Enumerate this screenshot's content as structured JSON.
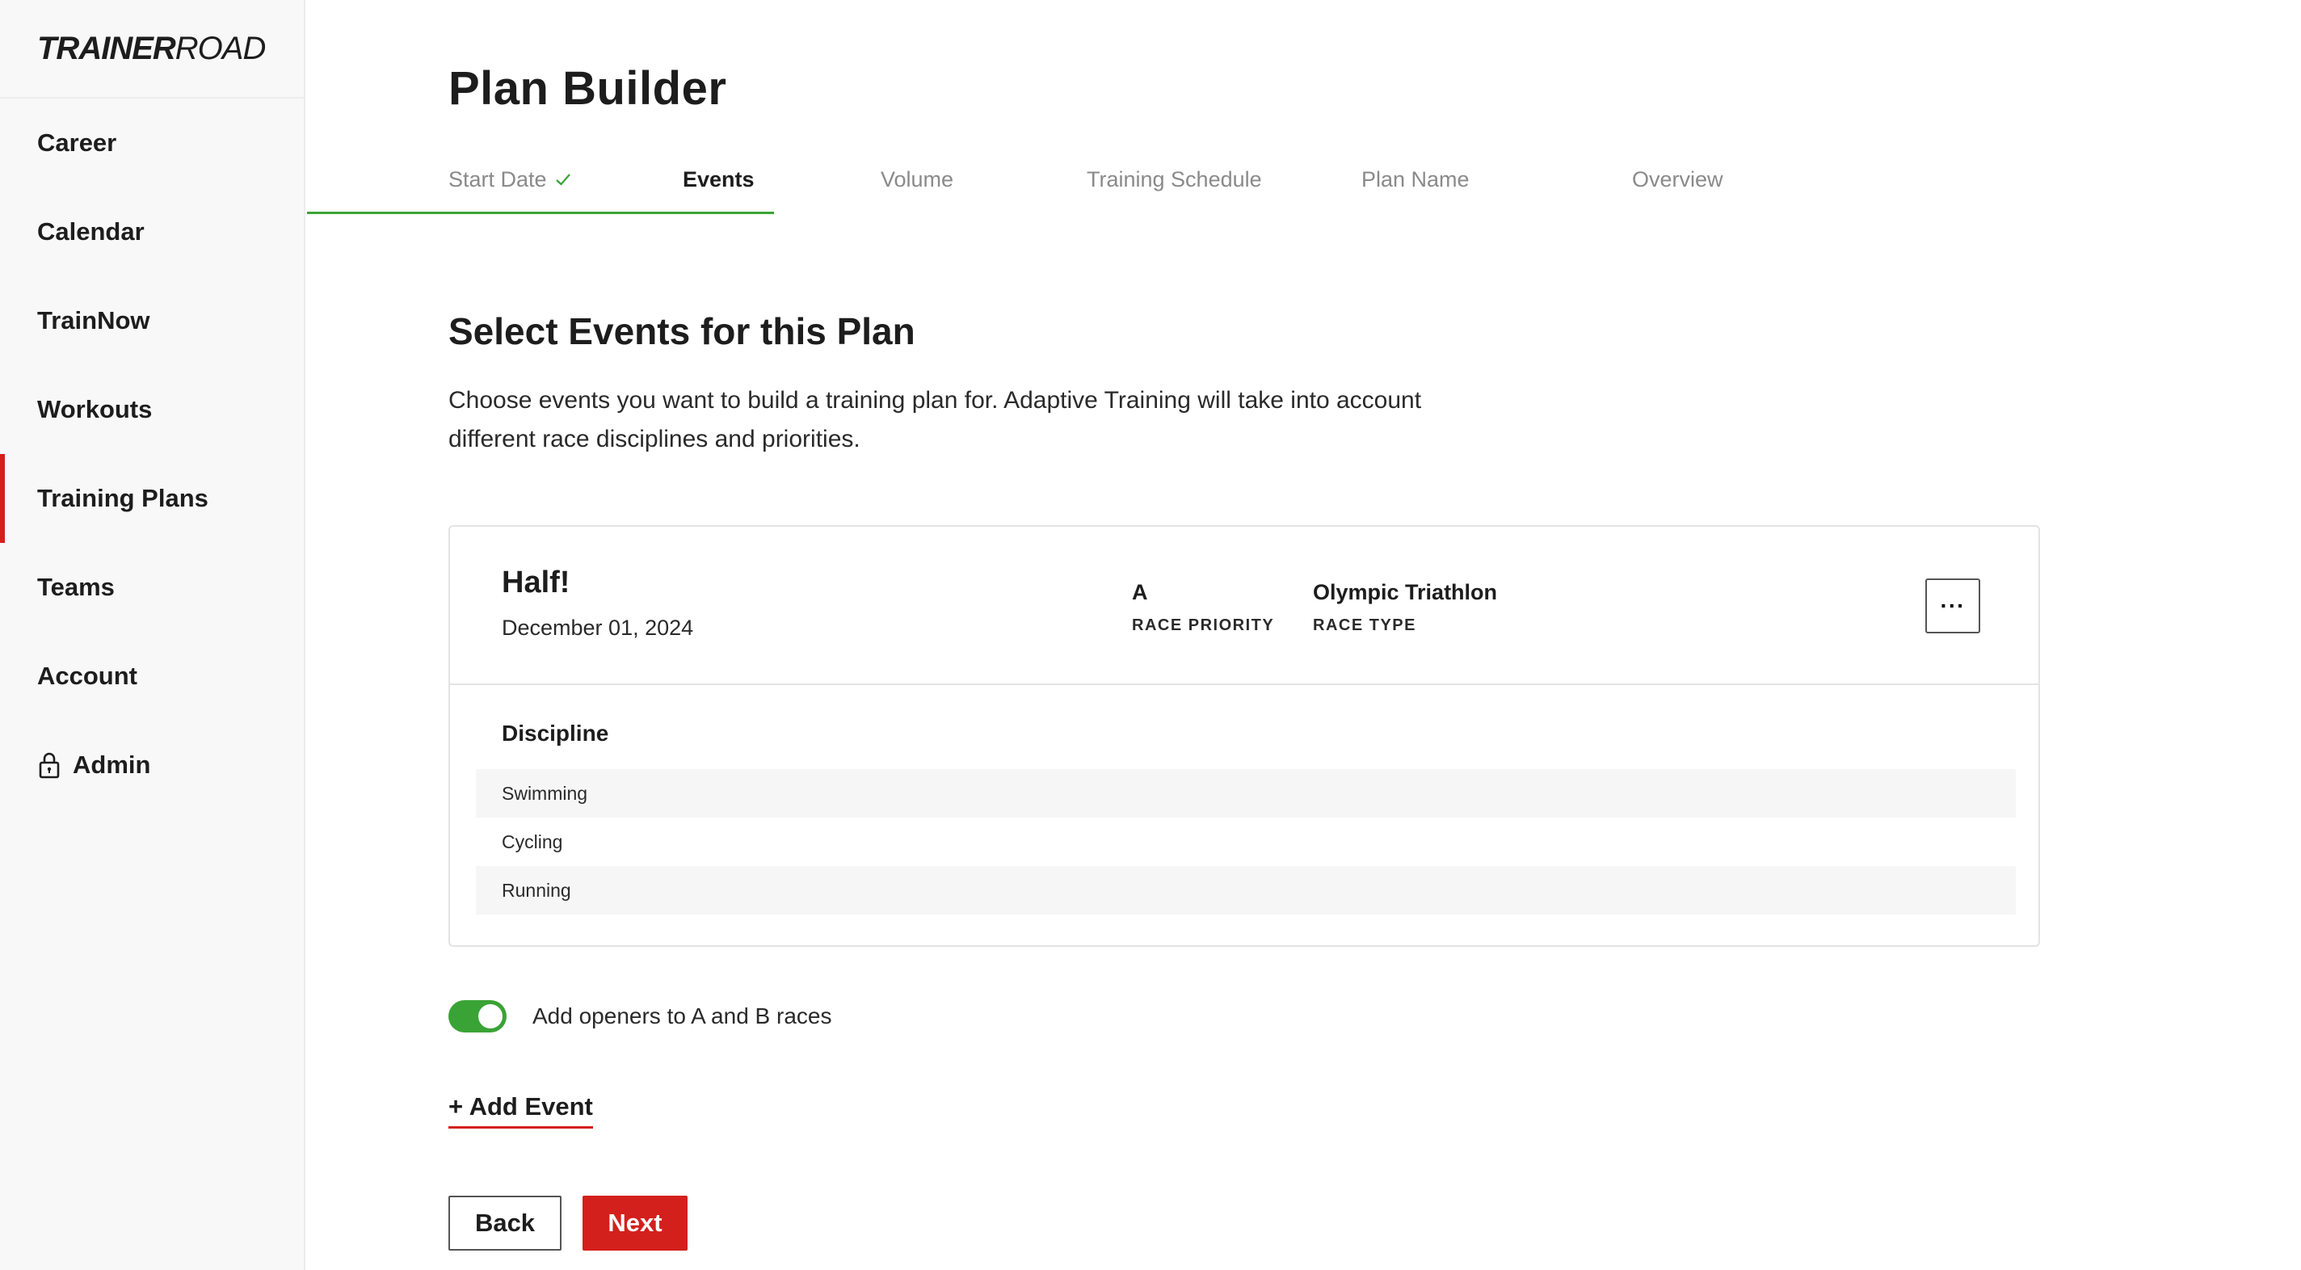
{
  "brand": {
    "logo_bold": "TRAINER",
    "logo_light": "ROAD"
  },
  "sidebar": {
    "items": [
      {
        "label": "Career"
      },
      {
        "label": "Calendar"
      },
      {
        "label": "TrainNow"
      },
      {
        "label": "Workouts"
      },
      {
        "label": "Training Plans",
        "active": true
      },
      {
        "label": "Teams"
      },
      {
        "label": "Account"
      },
      {
        "label": "Admin",
        "icon": "lock-icon"
      }
    ]
  },
  "page": {
    "title": "Plan Builder"
  },
  "steps": [
    {
      "label": "Start Date",
      "state": "completed",
      "icon": "check-icon"
    },
    {
      "label": "Events",
      "state": "current"
    },
    {
      "label": "Volume",
      "state": "upcoming"
    },
    {
      "label": "Training Schedule",
      "state": "upcoming"
    },
    {
      "label": "Plan Name",
      "state": "upcoming"
    },
    {
      "label": "Overview",
      "state": "upcoming"
    }
  ],
  "section": {
    "title": "Select Events for this Plan",
    "description": "Choose events you want to build a training plan for. Adaptive Training will take into account different race disciplines and priorities."
  },
  "event": {
    "name": "Half!",
    "date": "December 01, 2024",
    "race_priority": {
      "value": "A",
      "label": "RACE PRIORITY"
    },
    "race_type": {
      "value": "Olympic Triathlon",
      "label": "RACE TYPE"
    },
    "more_label": "···",
    "discipline_title": "Discipline",
    "disciplines": [
      "Swimming",
      "Cycling",
      "Running"
    ]
  },
  "openers": {
    "label": "Add openers to A and B races",
    "enabled": true
  },
  "actions": {
    "add_event": "+ Add Event",
    "back": "Back",
    "next": "Next"
  },
  "colors": {
    "accent_red": "#d3201c",
    "success_green": "#3aa335"
  }
}
